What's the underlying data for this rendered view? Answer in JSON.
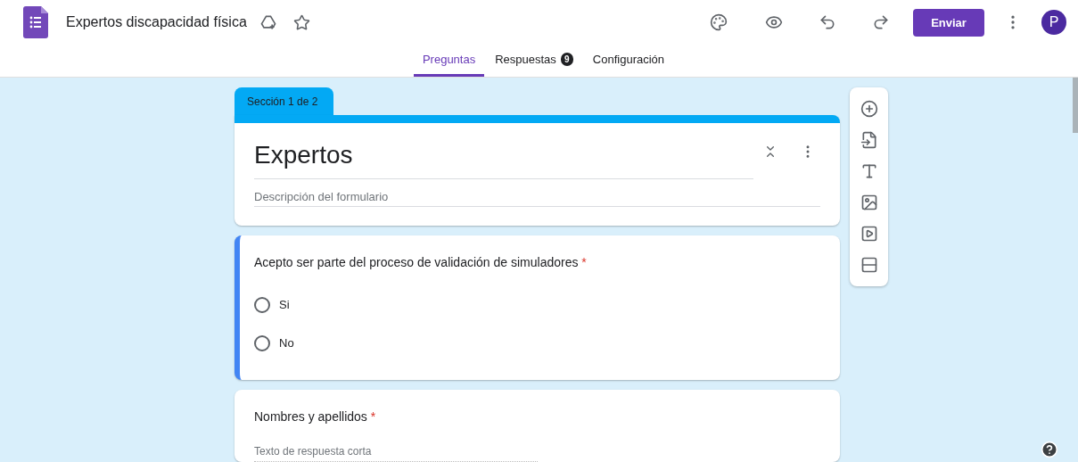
{
  "header": {
    "title": "Expertos discapacidad física",
    "send_button": "Enviar",
    "avatar": "P"
  },
  "tabs": [
    {
      "label": "Preguntas",
      "selected": true
    },
    {
      "label": "Respuestas",
      "selected": false,
      "badge": "9"
    },
    {
      "label": "Configuración",
      "selected": false
    }
  ],
  "section_tab": "Sección 1 de 2",
  "form_header": {
    "title": "Expertos",
    "description_placeholder": "Descripción del formulario"
  },
  "questions": [
    {
      "kind": "choice",
      "title": "Acepto ser parte del proceso de validación de simuladores",
      "required": true,
      "required_mark": "*",
      "active": true,
      "options": [
        {
          "label": "Si",
          "selected": false
        },
        {
          "label": "No",
          "selected": false
        }
      ]
    },
    {
      "kind": "short",
      "title": "Nombres y apellidos",
      "required": true,
      "required_mark": "*",
      "active": false,
      "placeholder": "Texto de respuesta corta"
    }
  ]
}
